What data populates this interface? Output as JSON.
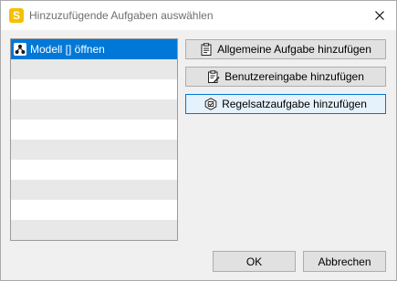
{
  "window": {
    "title": "Hinzuzufügende Aufgaben auswählen",
    "app_icon_letter": "S",
    "accent": "#0078d7",
    "app_color": "#f5c000"
  },
  "task_list": {
    "items": [
      {
        "label": "Modell [] öffnen",
        "icon": "model-icon",
        "selected": true
      }
    ]
  },
  "actions": {
    "general_task": {
      "label": "Allgemeine Aufgabe hinzufügen",
      "icon": "clipboard-icon"
    },
    "user_input": {
      "label": "Benutzereingabe hinzufügen",
      "icon": "clipboard-edit-icon"
    },
    "ruleset_task": {
      "label": "Regelsatzaufgabe hinzufügen",
      "icon": "ruleset-icon"
    }
  },
  "footer": {
    "ok_label": "OK",
    "cancel_label": "Abbrechen"
  }
}
